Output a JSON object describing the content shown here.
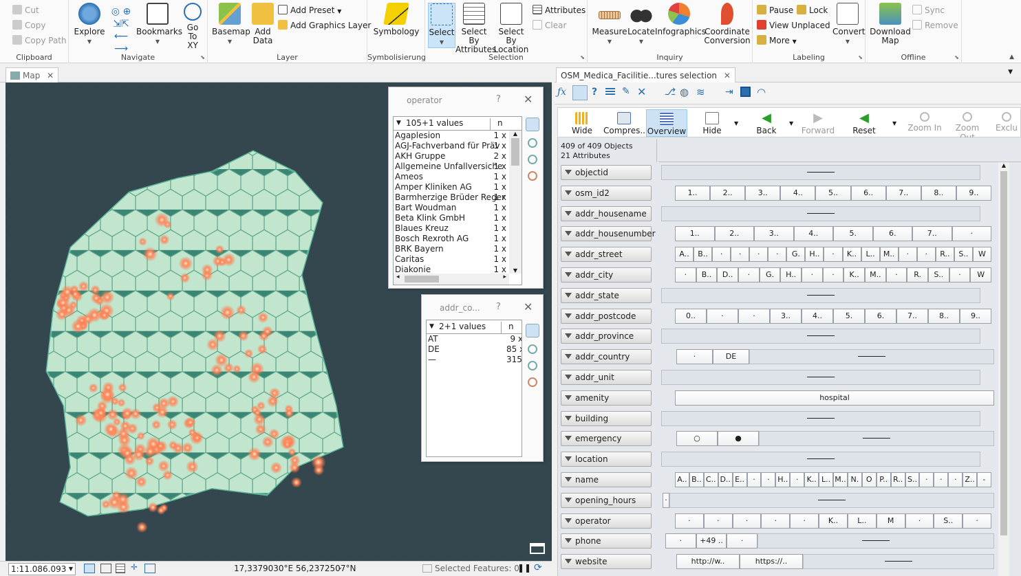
{
  "ribbon": {
    "clipboard": {
      "title": "Clipboard",
      "cut": "Cut",
      "copy": "Copy",
      "copy_path": "Copy Path"
    },
    "navigate": {
      "title": "Navigate",
      "explore": "Explore",
      "bookmarks": "Bookmarks",
      "go_to_xy": "Go To XY"
    },
    "layer": {
      "title": "Layer",
      "basemap": "Basemap",
      "add_data": "Add Data",
      "add_preset": "Add Preset",
      "add_graphics_layer": "Add Graphics Layer"
    },
    "symbolisierung": {
      "title": "Symbolisierung",
      "symbology": "Symbology"
    },
    "selection": {
      "title": "Selection",
      "select": "Select",
      "select_by_attributes": "Select By Attributes",
      "select_by_location": "Select By Location",
      "attributes": "Attributes",
      "clear": "Clear"
    },
    "inquiry": {
      "title": "Inquiry",
      "measure": "Measure",
      "locate": "Locate",
      "infographics": "Infographics",
      "coordinate_conversion": "Coordinate Conversion"
    },
    "labeling": {
      "title": "Labeling",
      "pause": "Pause",
      "lock": "Lock",
      "view_unplaced": "View Unplaced",
      "more": "More",
      "convert": "Convert"
    },
    "offline": {
      "title": "Offline",
      "download_map": "Download Map",
      "sync": "Sync",
      "remove": "Remove"
    }
  },
  "map_pane": {
    "tab_label": "Map",
    "scale": "1:11.086.093",
    "coordinates": "17,3379030°E 56,2372507°N",
    "selected_features": "Selected Features: 0"
  },
  "operator_window": {
    "title": "operator",
    "values_header": "105+1 values",
    "n_header": "n",
    "rows": [
      {
        "name": "Agaplesion",
        "count": "1 x"
      },
      {
        "name": "AGJ-Fachverband für Präv",
        "count": "1 x"
      },
      {
        "name": "AKH Gruppe",
        "count": "2 x"
      },
      {
        "name": "Allgemeine Unfallversiche",
        "count": "1 x"
      },
      {
        "name": "Ameos",
        "count": "1 x"
      },
      {
        "name": "Amper Kliniken AG",
        "count": "1 x"
      },
      {
        "name": "Barmherzige Brüder Reger",
        "count": "1 x"
      },
      {
        "name": "Bart Woudman",
        "count": "1 x"
      },
      {
        "name": "Beta Klink GmbH",
        "count": "1 x"
      },
      {
        "name": "Blaues Kreuz",
        "count": "1 x"
      },
      {
        "name": "Bosch Rexroth AG",
        "count": "1 x"
      },
      {
        "name": "BRK Bayern",
        "count": "1 x"
      },
      {
        "name": "Caritas",
        "count": "1 x"
      },
      {
        "name": "Diakonie",
        "count": "1 x"
      }
    ]
  },
  "country_window": {
    "title": "addr_co...",
    "values_header": "2+1 values",
    "n_header": "n",
    "rows": [
      {
        "name": "AT",
        "count": "9 x"
      },
      {
        "name": "DE",
        "count": "85 x"
      },
      {
        "name": "—",
        "count": "315 x"
      }
    ]
  },
  "attr_pane": {
    "tab_label": "OSM_Medica_Facilitie...tures selection",
    "view_buttons": {
      "wide": "Wide",
      "compress": "Compres...",
      "overview": "Overview",
      "hide": "Hide",
      "back": "Back",
      "forward": "Forward",
      "reset": "Reset",
      "zoom_in": "Zoom In",
      "zoom_out": "Zoom Out",
      "exclude": "Exclu"
    },
    "object_count": "409 of 409 Objects",
    "attribute_count": "21 Attributes",
    "attributes": [
      {
        "name": "objectid"
      },
      {
        "name": "osm_id2",
        "cats": [
          "1..",
          "2..",
          "3..",
          "4..",
          "5..",
          "6..",
          "7..",
          "8..",
          "9.."
        ]
      },
      {
        "name": "addr_housename"
      },
      {
        "name": "addr_housenumber",
        "cats": [
          "1..",
          "2..",
          "3..",
          "4..",
          "5.",
          "6.",
          "7..",
          "·"
        ]
      },
      {
        "name": "addr_street",
        "cats": [
          "A..",
          "B..",
          "·",
          "·",
          "·",
          "·",
          "G.",
          "H..",
          "·",
          "K..",
          "L..",
          "M..",
          "·",
          "·",
          "R..",
          "S..",
          "W"
        ]
      },
      {
        "name": "addr_city",
        "cats": [
          "·",
          "B..",
          "D..",
          "·",
          "G.",
          "H..",
          "·",
          "·",
          "K..",
          "M..",
          "·",
          "R.",
          "S..",
          "·",
          "W"
        ]
      },
      {
        "name": "addr_state"
      },
      {
        "name": "addr_postcode",
        "cats": [
          "0..",
          "·",
          "·",
          "3..",
          "4..",
          "5.",
          "6.",
          "7..",
          "8..",
          "9.."
        ]
      },
      {
        "name": "addr_province"
      },
      {
        "name": "addr_country",
        "cats": [
          "·",
          "DE"
        ]
      },
      {
        "name": "addr_unit"
      },
      {
        "name": "amenity",
        "cats": [
          "hospital"
        ]
      },
      {
        "name": "building"
      },
      {
        "name": "emergency",
        "cats": [
          "○",
          "●"
        ]
      },
      {
        "name": "location"
      },
      {
        "name": "name",
        "cats": [
          "A..",
          "B..",
          "C..",
          "D..",
          "E..",
          "·",
          "·",
          "H..",
          "·",
          "K..",
          "L..",
          "M..",
          "N.",
          "O",
          "P..",
          "R..",
          "S..",
          "·",
          "·",
          "·",
          "Z..",
          "-"
        ]
      },
      {
        "name": "opening_hours",
        "cats": [
          "·"
        ]
      },
      {
        "name": "operator",
        "cats": [
          "·",
          "·",
          "·",
          "·",
          "·",
          "K..",
          "L..",
          "M",
          "·",
          "S..",
          "·"
        ]
      },
      {
        "name": "phone",
        "cats": [
          "·",
          "+49 ..",
          "·"
        ]
      },
      {
        "name": "website",
        "cats": [
          "http://w..",
          "https://.."
        ]
      }
    ]
  }
}
